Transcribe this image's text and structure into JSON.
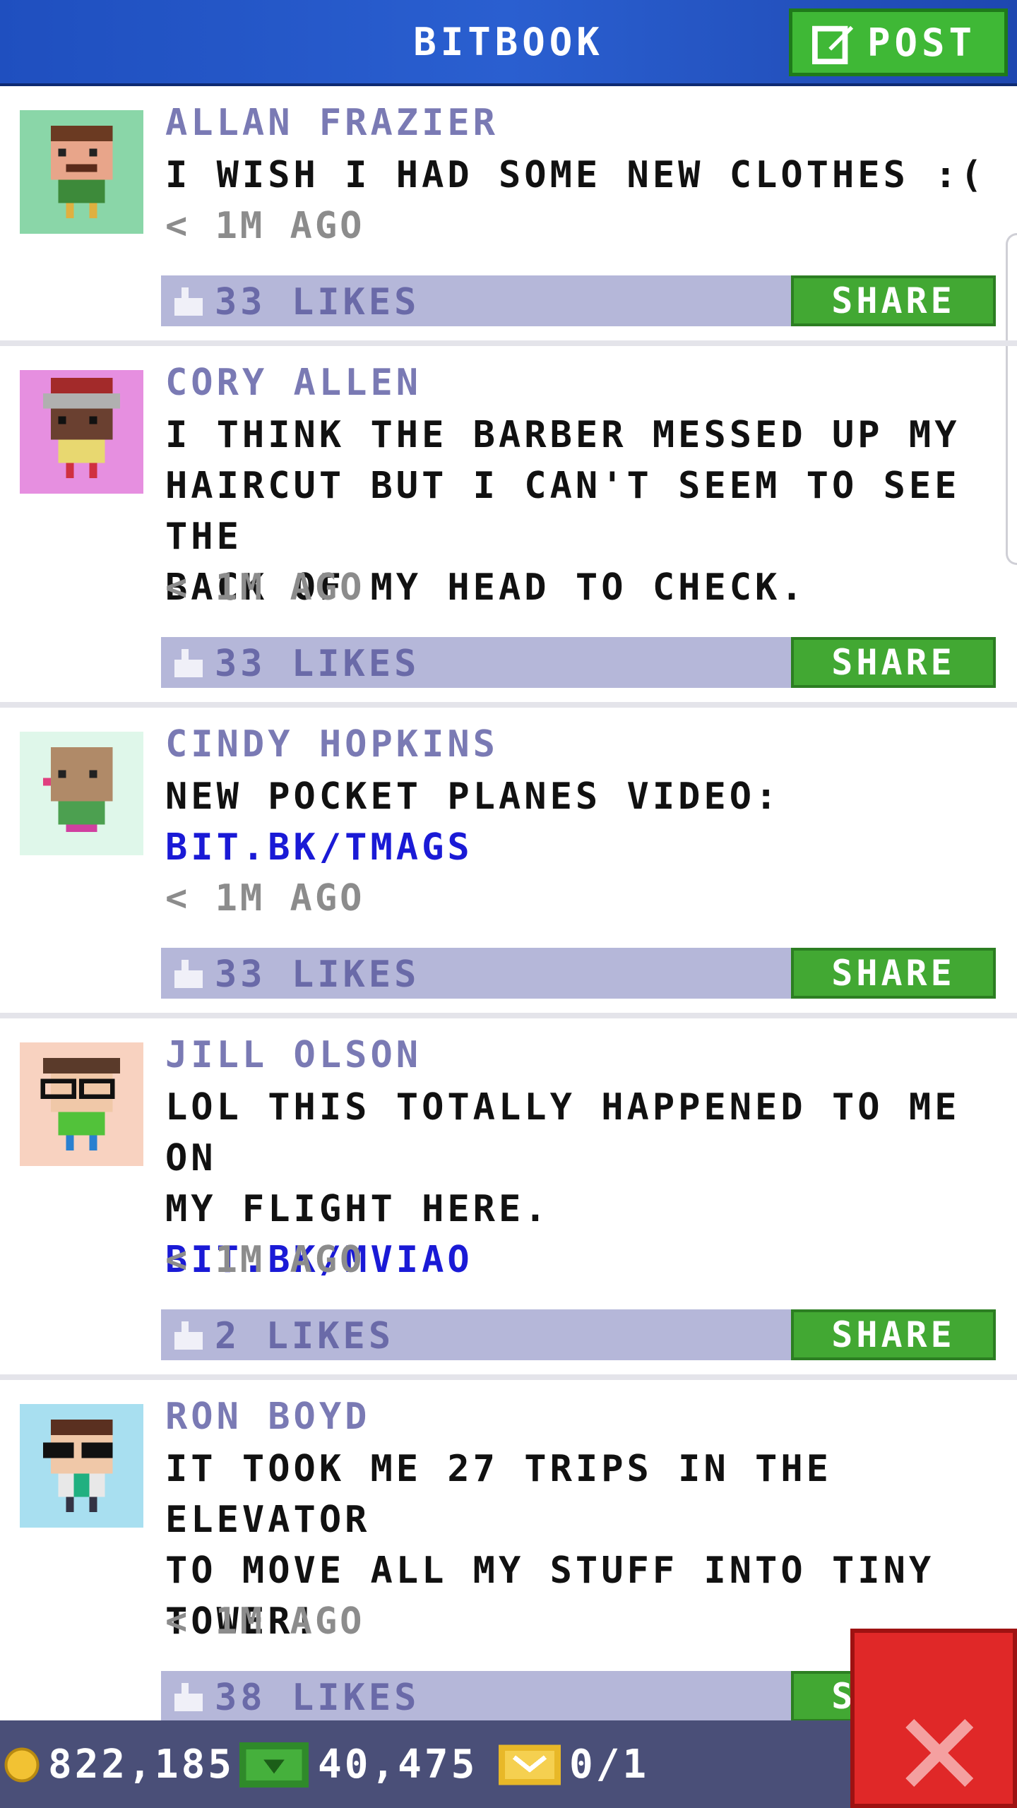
{
  "header": {
    "title": "BITBOOK",
    "post_label": "POST"
  },
  "share_label": "SHARE",
  "posts": [
    {
      "author": "ALLAN FRAZIER",
      "lines": [
        "I WISH I HAD SOME NEW CLOTHES :("
      ],
      "link": "",
      "time": "< 1M AGO",
      "likes": "33 LIKES",
      "avatar_bg": "#8ad6a8"
    },
    {
      "author": "CORY ALLEN",
      "lines": [
        "I THINK THE BARBER MESSED UP MY",
        "HAIRCUT BUT I CAN'T SEEM TO SEE THE",
        "BACK OF MY HEAD TO CHECK."
      ],
      "link": "",
      "time": "< 1M AGO",
      "likes": "33 LIKES",
      "avatar_bg": "#e68fe0"
    },
    {
      "author": "CINDY HOPKINS",
      "lines": [
        "NEW POCKET PLANES VIDEO:"
      ],
      "link": "BIT.BK/TMAGS",
      "time": "< 1M AGO",
      "likes": "33 LIKES",
      "avatar_bg": "#dff7ea"
    },
    {
      "author": "JILL OLSON",
      "lines": [
        "LOL THIS TOTALLY HAPPENED TO ME ON",
        "MY FLIGHT HERE."
      ],
      "link": "BIT.BK/MVIAO",
      "time": "< 1M AGO",
      "likes": "2 LIKES",
      "avatar_bg": "#f8d2c0"
    },
    {
      "author": "RON BOYD",
      "lines": [
        "IT TOOK ME 27 TRIPS IN THE ELEVATOR",
        "TO MOVE ALL MY STUFF INTO TINY",
        "TOWER!"
      ],
      "link": "",
      "time": "< 1M AGO",
      "likes": "38 LIKES",
      "avatar_bg": "#a8dff0"
    }
  ],
  "status": {
    "coins": "822,185",
    "bux": "40,475",
    "tickets": "0/1"
  },
  "icons": {
    "post": "compose-icon",
    "like": "thumbs-up-icon",
    "coin": "coin-icon",
    "bux": "bux-icon",
    "ticket": "ticket-icon",
    "close": "close-icon"
  },
  "colors": {
    "header": "#2a5fd0",
    "green": "#42a833",
    "likes_bar": "#b5b7d9",
    "link": "#1a1ad6",
    "close": "#e02828"
  }
}
